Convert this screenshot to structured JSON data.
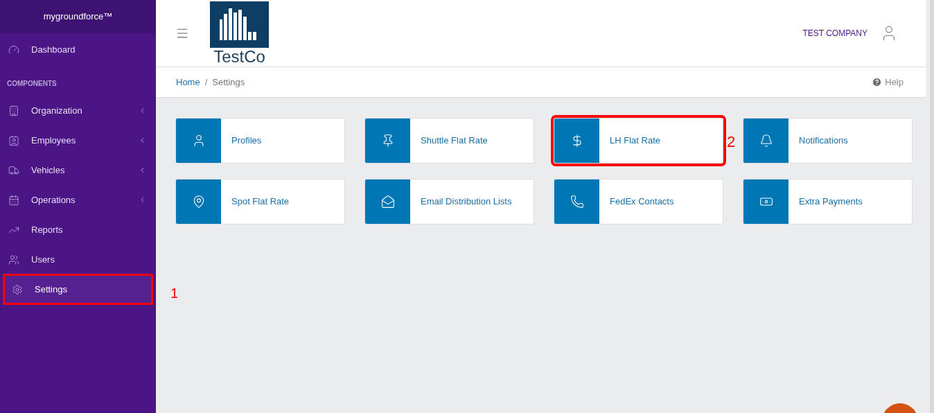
{
  "sidebar": {
    "brand": "mygroundforce™",
    "items": [
      {
        "label": "Dashboard",
        "selected": false,
        "expandable": false,
        "annotated": false
      },
      {
        "section": "COMPONENTS"
      },
      {
        "label": "Organization",
        "selected": false,
        "expandable": true,
        "annotated": false
      },
      {
        "label": "Employees",
        "selected": false,
        "expandable": true,
        "annotated": false
      },
      {
        "label": "Vehicles",
        "selected": false,
        "expandable": true,
        "annotated": false
      },
      {
        "label": "Operations",
        "selected": false,
        "expandable": true,
        "annotated": false
      },
      {
        "label": "Reports",
        "selected": false,
        "expandable": false,
        "annotated": false
      },
      {
        "label": "Users",
        "selected": false,
        "expandable": false,
        "annotated": false
      },
      {
        "label": "Settings",
        "selected": true,
        "expandable": false,
        "annotated": true,
        "annotation_label": "1"
      }
    ]
  },
  "header": {
    "logo_text": "TestCo",
    "company": "TEST COMPANY"
  },
  "breadcrumb": {
    "items": [
      "Home",
      "Settings"
    ],
    "separator": "/",
    "help": "Help"
  },
  "cards": [
    {
      "label": "Profiles",
      "annotated": false
    },
    {
      "label": "Shuttle Flat Rate",
      "annotated": false
    },
    {
      "label": "LH Flat Rate",
      "annotated": true,
      "annotation_label": "2"
    },
    {
      "label": "Notifications",
      "annotated": false
    },
    {
      "label": "Spot Flat Rate",
      "annotated": false
    },
    {
      "label": "Email Distribution Lists",
      "annotated": false
    },
    {
      "label": "FedEx Contacts",
      "annotated": false
    },
    {
      "label": "Extra Payments",
      "annotated": false
    }
  ]
}
